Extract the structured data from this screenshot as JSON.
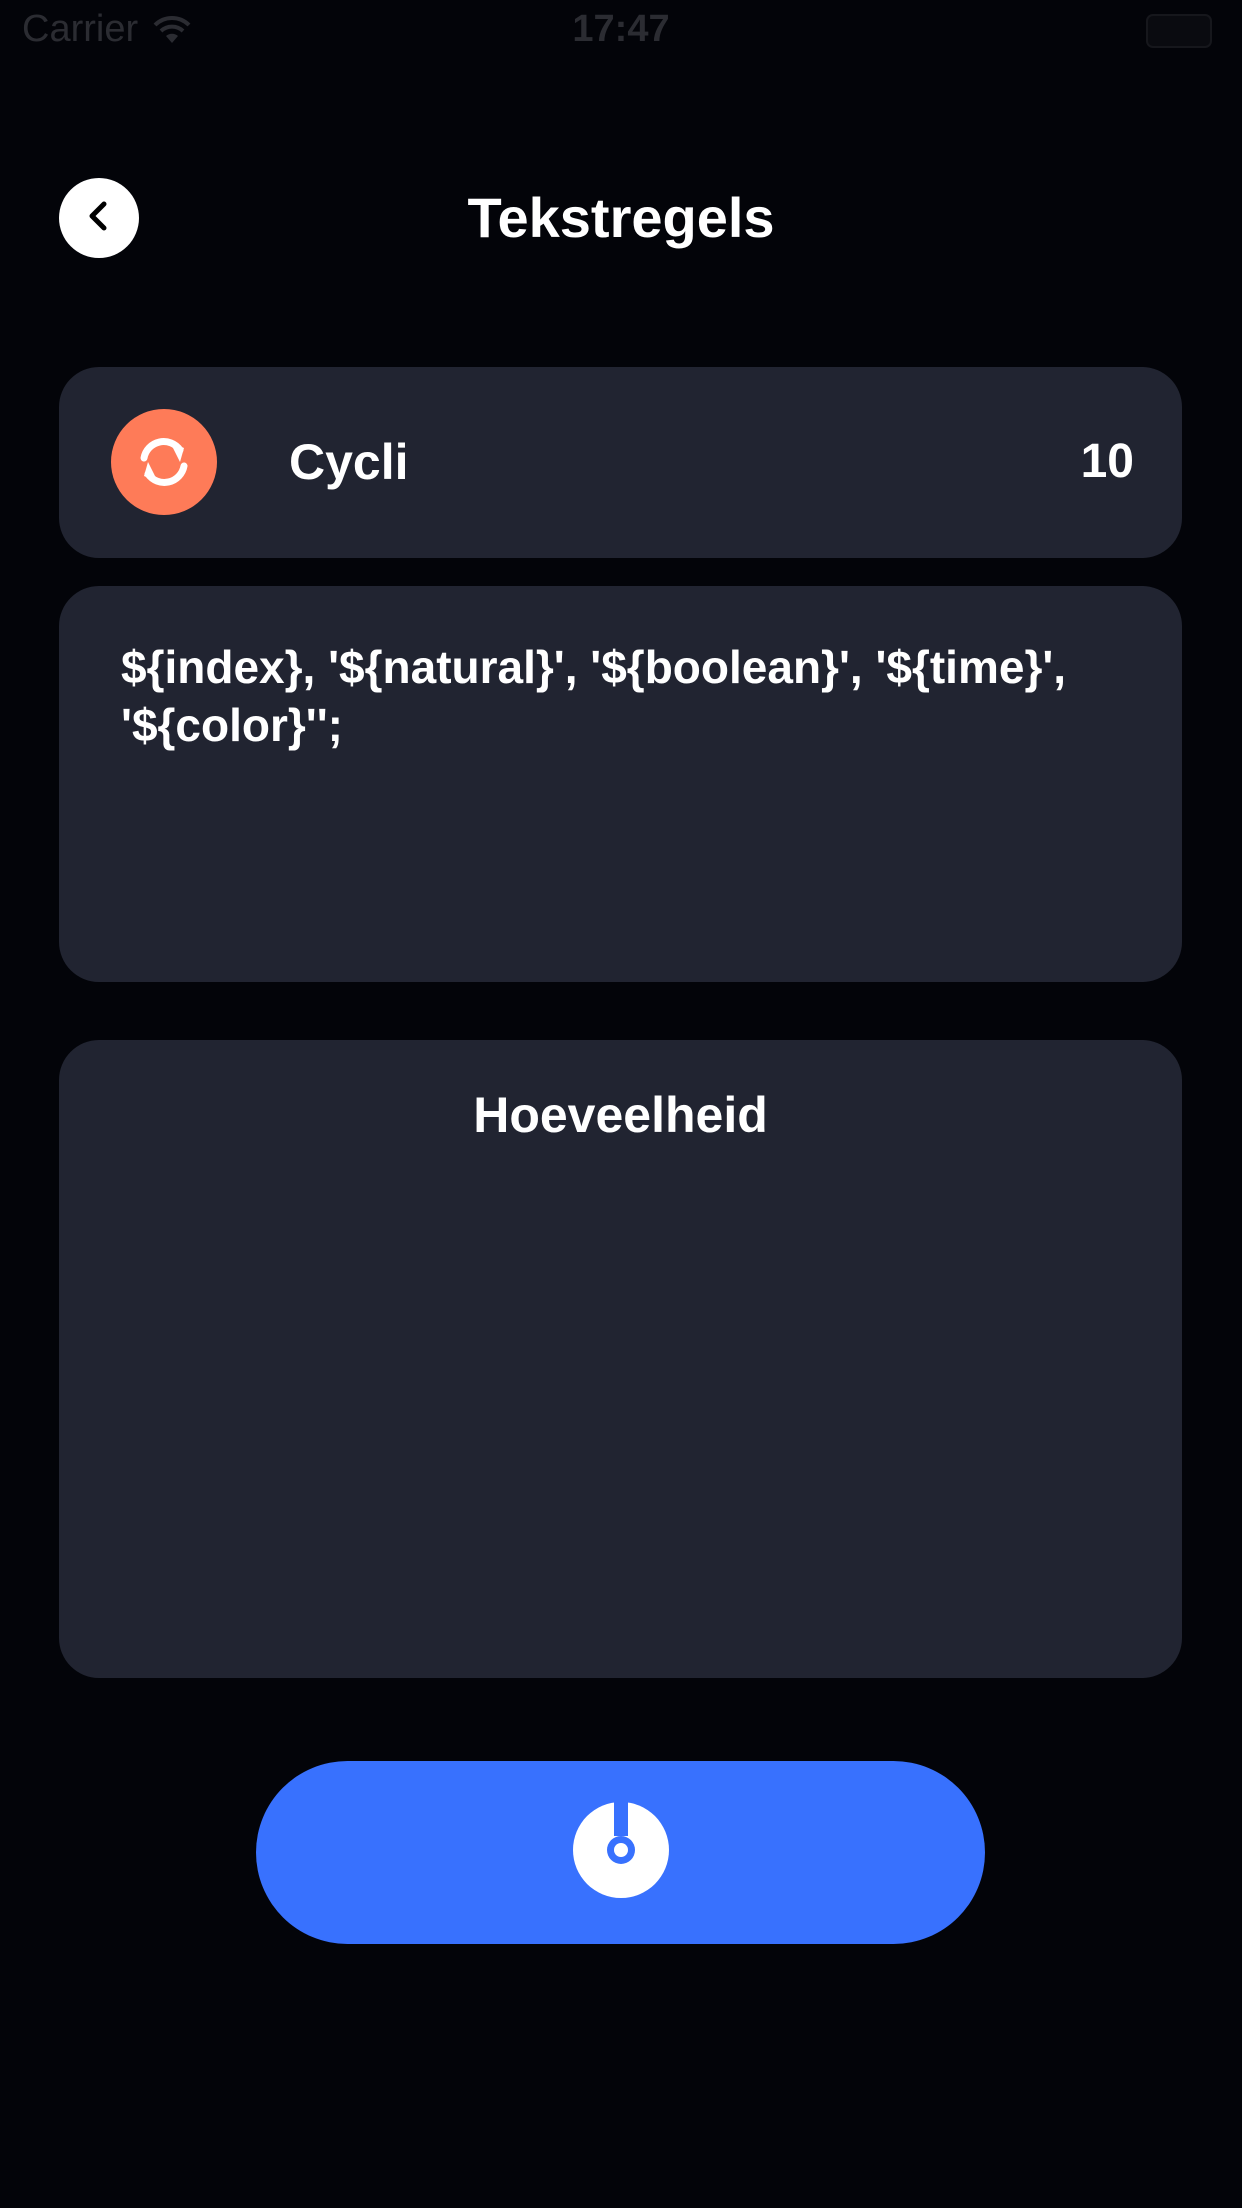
{
  "status_bar": {
    "carrier": "Carrier",
    "time": "17:47"
  },
  "header": {
    "title": "Tekstregels",
    "back_icon": "chevron-left-icon"
  },
  "cycles": {
    "label": "Cycli",
    "value": "10",
    "icon": "refresh-icon",
    "icon_color": "#fe7b58"
  },
  "template": {
    "text": "${index}, '${natural}', '${boolean}', '${time}', '${color}'';"
  },
  "amount": {
    "label": "Hoeveelheid"
  },
  "generate_button": {
    "icon": "power-icon",
    "color": "#3871fe"
  },
  "colors": {
    "background": "#030409",
    "card": "#212431",
    "text": "#ffffff"
  }
}
